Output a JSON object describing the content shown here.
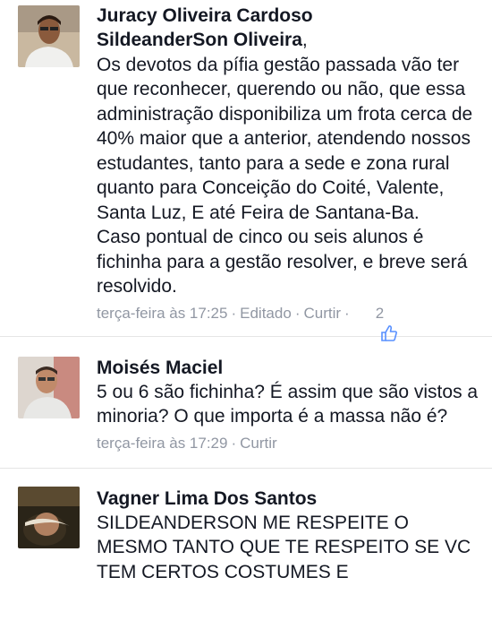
{
  "comments": [
    {
      "author": "Juracy Oliveira Cardoso",
      "mention": "SildeanderSon Oliveira",
      "mention_suffix": ",",
      "text": "Os devotos da pífia gestão passada vão ter que reconhecer, querendo ou não, que essa administração disponibiliza um frota cerca de 40% maior que a anterior,  atendendo nossos estudantes, tanto para a sede e zona rural quanto para Conceição do Coité, Valente, Santa Luz, E até Feira de Santana-Ba.\nCaso pontual de cinco ou seis alunos é fichinha para a gestão resolver, e breve será resolvido.",
      "time": "terça-feira às 17:25",
      "edited": "Editado",
      "action": "Curtir",
      "likes": "2"
    },
    {
      "author": "Moisés Maciel",
      "text": "5 ou 6 são fichinha? É assim que são vistos a minoria? O que importa é a massa não é?",
      "time": "terça-feira às 17:29",
      "action": "Curtir"
    },
    {
      "author": "Vagner Lima Dos Santos",
      "text": "SILDEANDERSON ME RESPEITE O MESMO TANTO QUE TE RESPEITO SE VC TEM CERTOS COSTUMES E"
    }
  ],
  "meta": {
    "separator": "·"
  },
  "colors": {
    "meta": "#9197a3",
    "text": "#141823",
    "like_icon": "#5890ff"
  },
  "icons": {
    "like": "thumbs-up-icon"
  }
}
